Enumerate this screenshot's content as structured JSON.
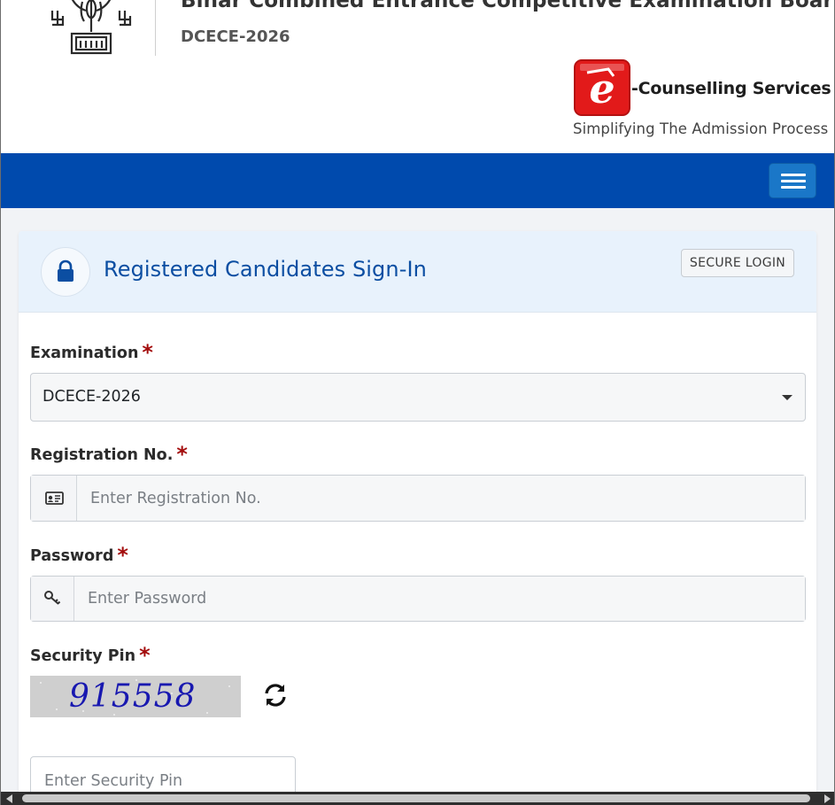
{
  "header": {
    "board_title": "Bihar Combined Entrance Competitive Examination Board",
    "exam_code": "DCECE-2026",
    "service_name": "-Counselling Services",
    "service_tagline": "Simplifying The Admission Process",
    "logo_letter": "e"
  },
  "navbar": {
    "color": "#004aad"
  },
  "card": {
    "title": "Registered Candidates Sign-In",
    "badge": "SECURE LOGIN"
  },
  "form": {
    "examination": {
      "label": "Examination",
      "required_mark": "*",
      "selected": "DCECE-2026"
    },
    "registration": {
      "label": "Registration No.",
      "required_mark": "*",
      "placeholder": "Enter Registration No."
    },
    "password": {
      "label": "Password",
      "required_mark": "*",
      "placeholder": "Enter Password"
    },
    "security_pin": {
      "label": "Security Pin",
      "required_mark": "*",
      "captcha_text": "915558",
      "placeholder": "Enter Security Pin"
    }
  }
}
